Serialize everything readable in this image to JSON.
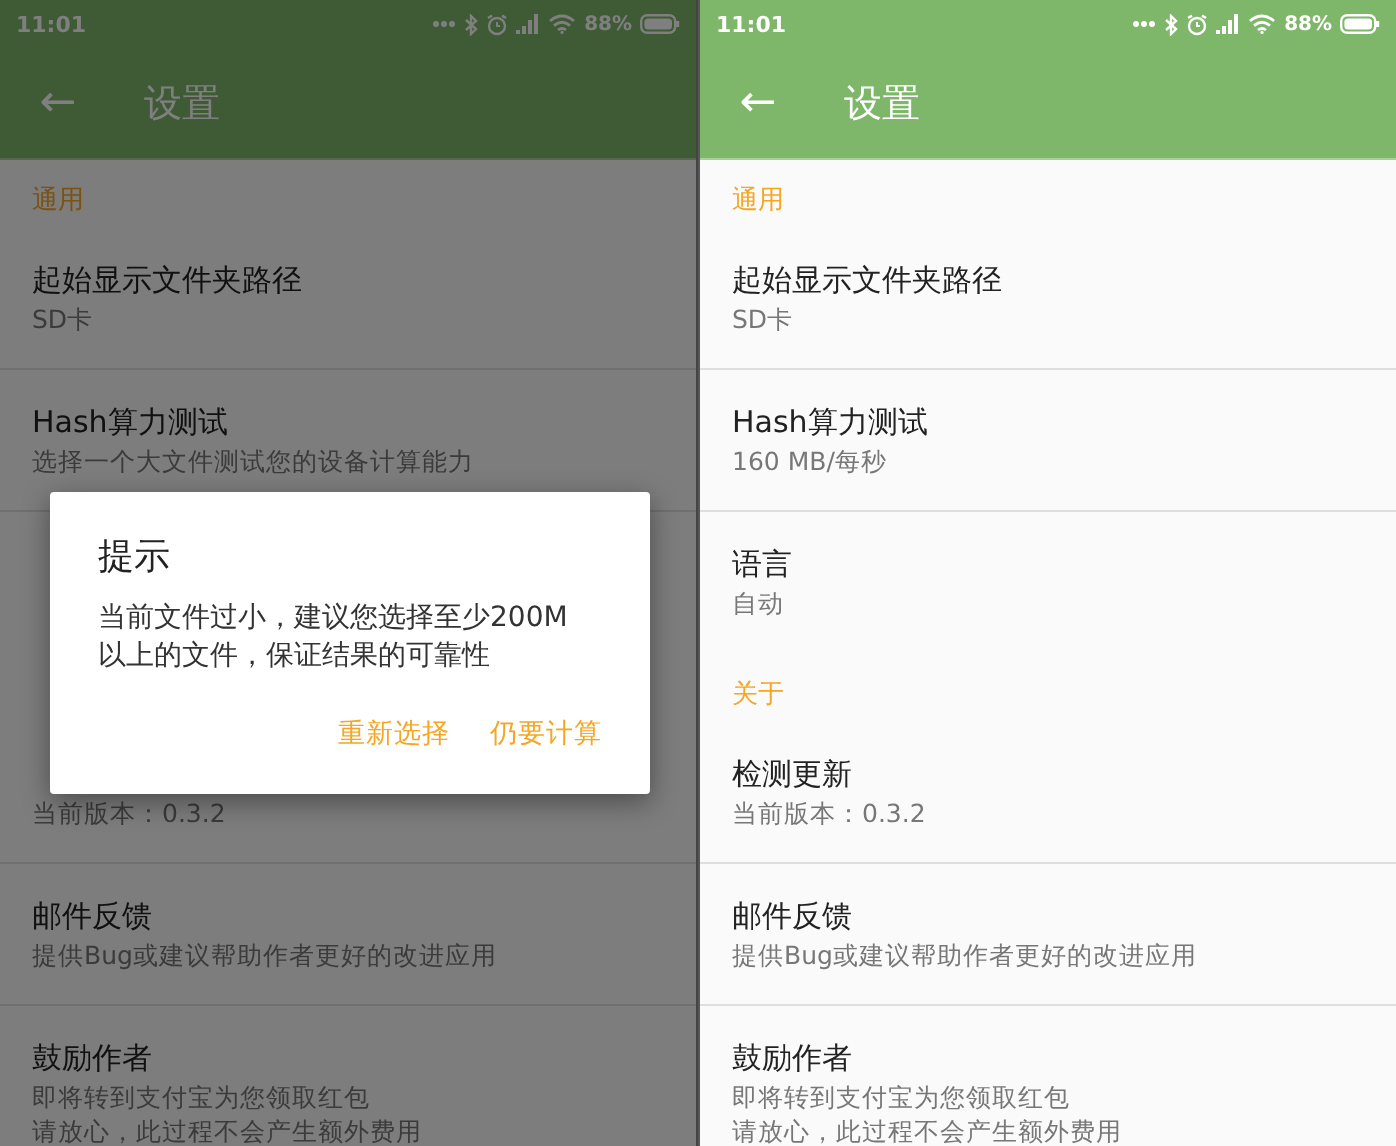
{
  "screens": [
    {
      "status_bar": {
        "time": "11:01",
        "battery": "88%"
      },
      "toolbar": {
        "back": "←",
        "title": "设置"
      },
      "rows": [
        {
          "kind": "header",
          "label": "通用"
        },
        {
          "kind": "item",
          "title": "起始显示文件夹路径",
          "subtitle": [
            "SD卡"
          ]
        },
        {
          "kind": "item",
          "title": "Hash算力测试",
          "subtitle": [
            "选择一个大文件测试您的设备计算能力"
          ]
        },
        {
          "kind": "item"
        },
        {
          "kind": "header"
        },
        {
          "kind": "item",
          "subtitle": [
            "当前版本：0.3.2"
          ]
        },
        {
          "kind": "item",
          "title": "邮件反馈",
          "subtitle": [
            "提供Bug或建议帮助作者更好的改进应用"
          ]
        },
        {
          "kind": "item",
          "title": "鼓励作者",
          "subtitle": [
            "即将转到支付宝为您领取红包",
            "请放心，此过程不会产生额外费用"
          ]
        }
      ],
      "dialog": {
        "title": "提示",
        "message": "当前文件过小，建议您选择至少200M以上的文件，保证结果的可靠性",
        "buttons": [
          "重新选择",
          "仍要计算"
        ]
      }
    },
    {
      "status_bar": {
        "time": "11:01",
        "battery": "88%"
      },
      "toolbar": {
        "back": "←",
        "title": "设置"
      },
      "rows": [
        {
          "kind": "header",
          "label": "通用"
        },
        {
          "kind": "item",
          "title": "起始显示文件夹路径",
          "subtitle": [
            "SD卡"
          ]
        },
        {
          "kind": "item",
          "title": "Hash算力测试",
          "subtitle": [
            "160 MB/每秒"
          ]
        },
        {
          "kind": "item",
          "title": "语言",
          "subtitle": [
            "自动"
          ]
        },
        {
          "kind": "header",
          "label": "关于"
        },
        {
          "kind": "item",
          "title": "检测更新",
          "subtitle": [
            "当前版本：0.3.2"
          ]
        },
        {
          "kind": "item",
          "title": "邮件反馈",
          "subtitle": [
            "提供Bug或建议帮助作者更好的改进应用"
          ]
        },
        {
          "kind": "item",
          "title": "鼓励作者",
          "subtitle": [
            "即将转到支付宝为您领取红包",
            "请放心，此过程不会产生额外费用"
          ]
        }
      ]
    }
  ]
}
